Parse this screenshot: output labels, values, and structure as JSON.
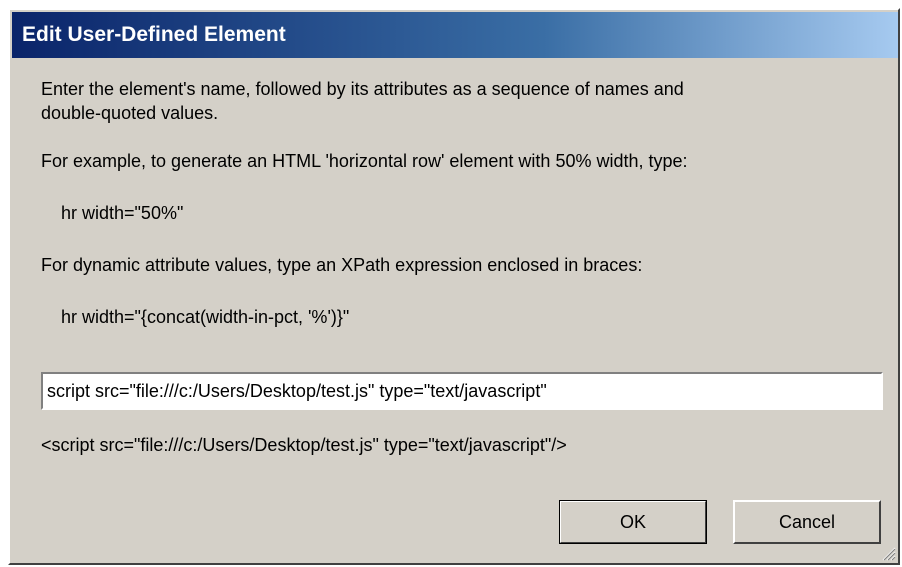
{
  "dialog": {
    "title": "Edit User-Defined Element",
    "instructions_1": "Enter the element's name, followed by its attributes as a sequence of names and",
    "instructions_1b": "double-quoted values.",
    "example_intro": "For example, to generate an HTML 'horizontal row' element with 50% width, type:",
    "example_code": "hr width=\"50%\"",
    "dynamic_intro": "For dynamic attribute values, type an XPath expression enclosed in braces:",
    "dynamic_code": "hr width=\"{concat(width-in-pct, '%')}\"",
    "input_value": "script src=\"file:///c:/Users/Desktop/test.js\" type=\"text/javascript\"",
    "preview": "<script src=\"file:///c:/Users/Desktop/test.js\" type=\"text/javascript\"/>",
    "ok_label": "OK",
    "cancel_label": "Cancel"
  }
}
